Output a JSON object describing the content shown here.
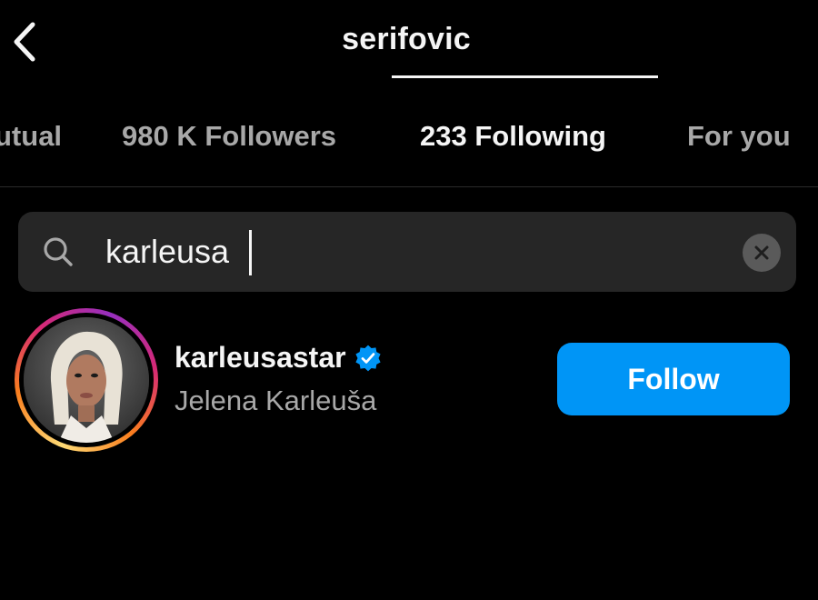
{
  "header": {
    "title": "serifovic",
    "back_icon": "chevron-left-icon"
  },
  "tabs": [
    {
      "label": "utual",
      "active": false
    },
    {
      "label": "980 K Followers",
      "active": false
    },
    {
      "label": "233 Following",
      "active": true
    },
    {
      "label": "For you",
      "active": false
    }
  ],
  "search": {
    "value": "karleusa",
    "icon": "search-icon",
    "clear_icon": "clear-icon"
  },
  "results": [
    {
      "username": "karleusastar",
      "full_name": "Jelena Karleuša",
      "verified": true,
      "has_story_ring": true,
      "button_label": "Follow"
    }
  ],
  "colors": {
    "background": "#000000",
    "search_bg": "#262626",
    "follow_button": "#0095f6",
    "verified_badge": "#0095f6",
    "secondary_text": "#a8a8a8"
  }
}
